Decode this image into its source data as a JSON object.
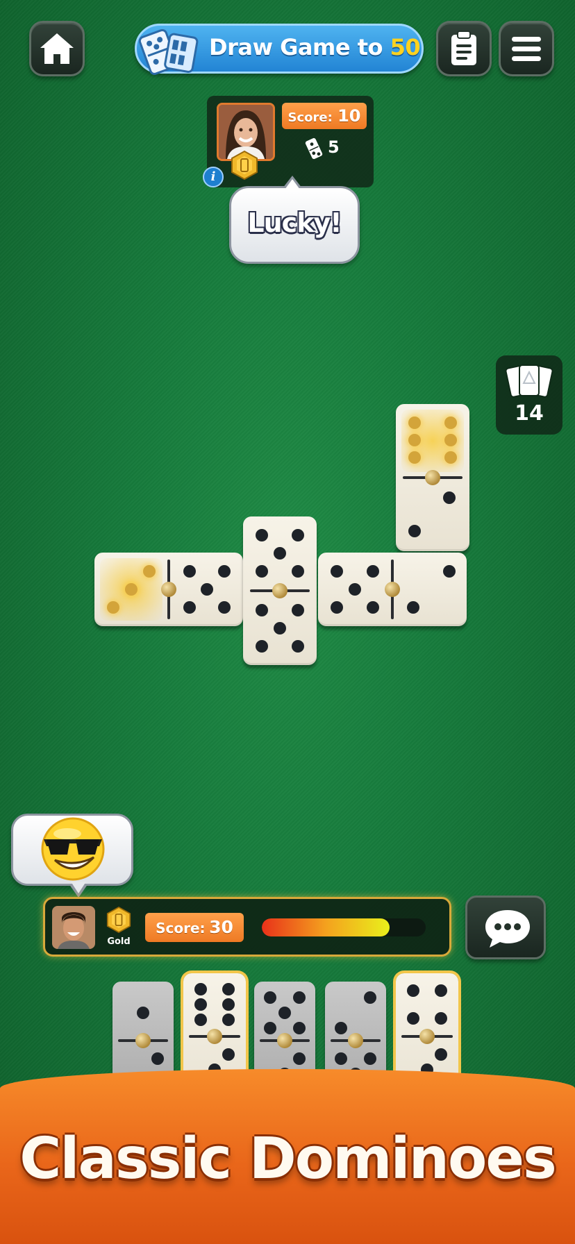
{
  "header": {
    "home_icon": "home-icon",
    "game_mode_prefix": "Draw Game to",
    "game_mode_target": "50",
    "scoreboard_icon": "clipboard-icon",
    "menu_icon": "hamburger-menu-icon"
  },
  "opponent": {
    "score_label": "Score:",
    "score_value": "10",
    "tiles_in_hand": "5",
    "rank_icon": "gold-rank-icon",
    "info_icon": "info-icon",
    "speech": "Lucky!"
  },
  "board": {
    "boneyard_count": "14",
    "tiles": [
      {
        "id": "left-horizontal",
        "ends": [
          3,
          5
        ],
        "highlight_end": 0
      },
      {
        "id": "center-spinner",
        "ends": [
          5,
          5
        ]
      },
      {
        "id": "right-horizontal",
        "ends": [
          5,
          2
        ]
      },
      {
        "id": "top-vertical",
        "ends": [
          6,
          2
        ],
        "highlight_end": 0
      }
    ]
  },
  "player": {
    "reaction_emoji": "sunglasses-emoji",
    "rank_label": "Gold",
    "score_label": "Score:",
    "score_value": "30",
    "turn_timer_fraction": 0.78,
    "chat_icon": "chat-bubble-icon"
  },
  "hand": [
    {
      "ends": [
        1,
        2
      ],
      "style": "gray",
      "playable": false
    },
    {
      "ends": [
        6,
        3
      ],
      "style": "white",
      "playable": true
    },
    {
      "ends": [
        5,
        3
      ],
      "style": "gray",
      "playable": false
    },
    {
      "ends": [
        2,
        5
      ],
      "style": "gray",
      "playable": false
    },
    {
      "ends": [
        4,
        3
      ],
      "style": "white",
      "playable": true
    }
  ],
  "banner": {
    "title": "Classic Dominoes"
  },
  "colors": {
    "felt": "#167a3b",
    "accent_orange": "#ee7a24",
    "accent_gold": "#d8a93a",
    "pill_blue": "#2284d4"
  }
}
